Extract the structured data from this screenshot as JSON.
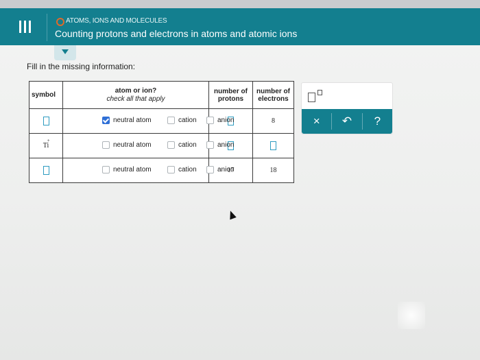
{
  "header": {
    "topic": "ATOMS, IONS AND MOLECULES",
    "title": "Counting protons and electrons in atoms and atomic ions"
  },
  "prompt": "Fill in the missing information:",
  "table": {
    "headers": {
      "symbol": "symbol",
      "atom_or_ion": "atom or ion?",
      "atom_or_ion_sub": "check all that apply",
      "protons": "number of protons",
      "electrons": "number of electrons"
    },
    "option_labels": {
      "neutral": "neutral atom",
      "cation": "cation",
      "anion": "anion"
    },
    "rows": [
      {
        "symbol": "",
        "neutral_checked": true,
        "cation_checked": false,
        "anion_checked": false,
        "protons": "",
        "electrons": "8"
      },
      {
        "symbol": "Ti",
        "symbol_charge": "+",
        "neutral_checked": false,
        "cation_checked": false,
        "anion_checked": false,
        "protons": "",
        "electrons": ""
      },
      {
        "symbol": "",
        "neutral_checked": false,
        "cation_checked": false,
        "anion_checked": false,
        "protons": "17",
        "electrons": "18"
      }
    ]
  },
  "tools": {
    "close": "×",
    "undo": "↶",
    "help": "?"
  },
  "colors": {
    "header_bg": "#137f8f",
    "topic_ring": "#e06a2a",
    "checkbox_checked": "#2f6fd6",
    "blank_input": "#2d9bc0"
  }
}
